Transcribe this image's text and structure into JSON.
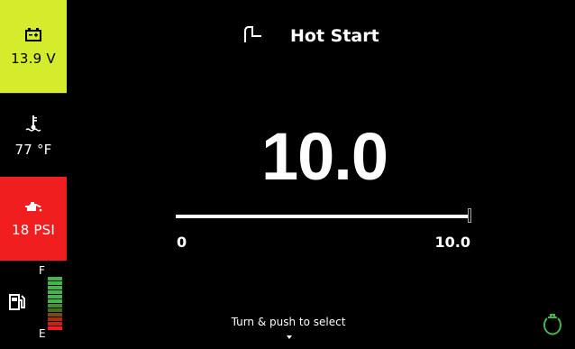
{
  "sidebar": {
    "voltage": {
      "value": "13.9 V",
      "icon": "battery-icon",
      "bg_color": "#d4ec2b"
    },
    "coolant_temp": {
      "value": "77 °F",
      "icon": "coolant-temperature-icon"
    },
    "oil_pressure": {
      "value": "18 PSI",
      "icon": "oil-pressure-icon",
      "bg_color": "#f01e1e"
    },
    "fuel": {
      "icon": "fuel-pump-icon",
      "full_label": "F",
      "empty_label": "E",
      "level_fraction": 1.0,
      "segments": [
        "#43b649",
        "#43b649",
        "#43b649",
        "#43b649",
        "#43b649",
        "#43b649",
        "#3d8f2a",
        "#4a6d1b",
        "#7a4a13",
        "#a3300f",
        "#d41d12",
        "#f01e1e"
      ]
    }
  },
  "header": {
    "title": "Hot Start",
    "icon": "hot-start-icon"
  },
  "setting": {
    "value": "10.0",
    "min_label": "0",
    "max_label": "10.0",
    "level_fraction": 1.0
  },
  "footer": {
    "hint": "Turn & push to select",
    "caret_icon": "caret-down-icon"
  },
  "status": {
    "engine_icon": "engine-status-icon",
    "engine_color": "#43b649"
  }
}
